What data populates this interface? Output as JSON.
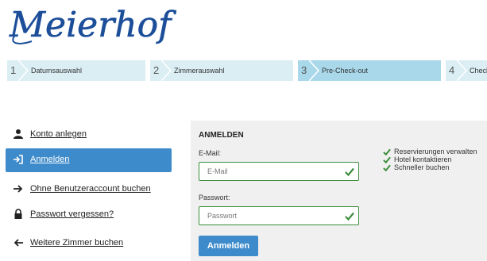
{
  "brand": {
    "logo_text": "Meierhof",
    "logo_color": "#1d4e9a"
  },
  "steps": [
    {
      "number": "1",
      "label": "Datumsauswahl",
      "active": false
    },
    {
      "number": "2",
      "label": "Zimmerauswahl",
      "active": false
    },
    {
      "number": "3",
      "label": "Pre-Check-out",
      "active": true
    },
    {
      "number": "4",
      "label": "Checkout",
      "active": false
    }
  ],
  "menu": [
    {
      "label": "Konto anlegen",
      "icon": "user-icon",
      "active": false
    },
    {
      "label": "Anmelden",
      "icon": "sign-in-icon",
      "active": true
    },
    {
      "label": "Ohne Benutzeraccount buchen",
      "icon": "arrow-right-icon",
      "active": false
    },
    {
      "label": "Passwort vergessen?",
      "icon": "lock-icon",
      "active": false
    },
    {
      "label": "Weitere Zimmer buchen",
      "icon": "arrow-left-icon",
      "active": false
    }
  ],
  "login": {
    "title": "ANMELDEN",
    "email_label": "E-Mail:",
    "email_placeholder": "E-Mail",
    "password_label": "Passwort:",
    "password_placeholder": "Passwort",
    "submit_label": "Anmelden"
  },
  "benefits": [
    "Reservierungen verwalten",
    "Hotel kontaktieren",
    "Schneller buchen"
  ],
  "colors": {
    "accent": "#3e8bcb",
    "step_bg": "#daeef4",
    "step_active": "#a9d8ea",
    "valid": "#3c8d3c",
    "panel_bg": "#f0f0f0"
  }
}
